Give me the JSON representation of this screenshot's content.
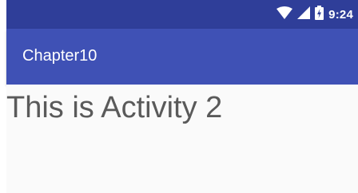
{
  "status_bar": {
    "time": "9:24",
    "icons": [
      "wifi-icon",
      "signal-icon",
      "battery-icon"
    ],
    "background": "#2f3e99"
  },
  "app_bar": {
    "title": "Chapter10",
    "background": "#3f51b5"
  },
  "content": {
    "text": "This is Activity 2",
    "text_color": "#5a5a5a"
  }
}
